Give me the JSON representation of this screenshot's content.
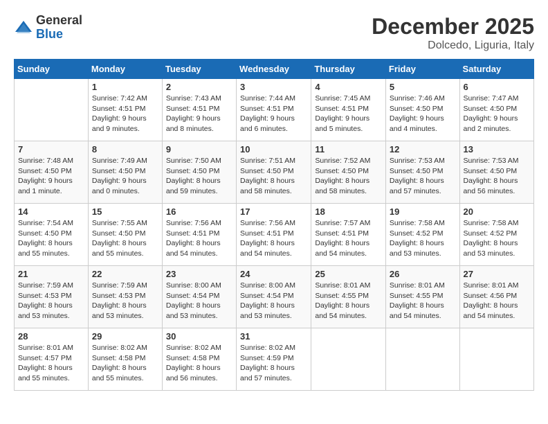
{
  "header": {
    "logo_general": "General",
    "logo_blue": "Blue",
    "month_year": "December 2025",
    "location": "Dolcedo, Liguria, Italy"
  },
  "calendar": {
    "days_of_week": [
      "Sunday",
      "Monday",
      "Tuesday",
      "Wednesday",
      "Thursday",
      "Friday",
      "Saturday"
    ],
    "weeks": [
      [
        {
          "day": "",
          "info": ""
        },
        {
          "day": "1",
          "info": "Sunrise: 7:42 AM\nSunset: 4:51 PM\nDaylight: 9 hours\nand 9 minutes."
        },
        {
          "day": "2",
          "info": "Sunrise: 7:43 AM\nSunset: 4:51 PM\nDaylight: 9 hours\nand 8 minutes."
        },
        {
          "day": "3",
          "info": "Sunrise: 7:44 AM\nSunset: 4:51 PM\nDaylight: 9 hours\nand 6 minutes."
        },
        {
          "day": "4",
          "info": "Sunrise: 7:45 AM\nSunset: 4:51 PM\nDaylight: 9 hours\nand 5 minutes."
        },
        {
          "day": "5",
          "info": "Sunrise: 7:46 AM\nSunset: 4:50 PM\nDaylight: 9 hours\nand 4 minutes."
        },
        {
          "day": "6",
          "info": "Sunrise: 7:47 AM\nSunset: 4:50 PM\nDaylight: 9 hours\nand 2 minutes."
        }
      ],
      [
        {
          "day": "7",
          "info": "Sunrise: 7:48 AM\nSunset: 4:50 PM\nDaylight: 9 hours\nand 1 minute."
        },
        {
          "day": "8",
          "info": "Sunrise: 7:49 AM\nSunset: 4:50 PM\nDaylight: 9 hours\nand 0 minutes."
        },
        {
          "day": "9",
          "info": "Sunrise: 7:50 AM\nSunset: 4:50 PM\nDaylight: 8 hours\nand 59 minutes."
        },
        {
          "day": "10",
          "info": "Sunrise: 7:51 AM\nSunset: 4:50 PM\nDaylight: 8 hours\nand 58 minutes."
        },
        {
          "day": "11",
          "info": "Sunrise: 7:52 AM\nSunset: 4:50 PM\nDaylight: 8 hours\nand 58 minutes."
        },
        {
          "day": "12",
          "info": "Sunrise: 7:53 AM\nSunset: 4:50 PM\nDaylight: 8 hours\nand 57 minutes."
        },
        {
          "day": "13",
          "info": "Sunrise: 7:53 AM\nSunset: 4:50 PM\nDaylight: 8 hours\nand 56 minutes."
        }
      ],
      [
        {
          "day": "14",
          "info": "Sunrise: 7:54 AM\nSunset: 4:50 PM\nDaylight: 8 hours\nand 55 minutes."
        },
        {
          "day": "15",
          "info": "Sunrise: 7:55 AM\nSunset: 4:50 PM\nDaylight: 8 hours\nand 55 minutes."
        },
        {
          "day": "16",
          "info": "Sunrise: 7:56 AM\nSunset: 4:51 PM\nDaylight: 8 hours\nand 54 minutes."
        },
        {
          "day": "17",
          "info": "Sunrise: 7:56 AM\nSunset: 4:51 PM\nDaylight: 8 hours\nand 54 minutes."
        },
        {
          "day": "18",
          "info": "Sunrise: 7:57 AM\nSunset: 4:51 PM\nDaylight: 8 hours\nand 54 minutes."
        },
        {
          "day": "19",
          "info": "Sunrise: 7:58 AM\nSunset: 4:52 PM\nDaylight: 8 hours\nand 53 minutes."
        },
        {
          "day": "20",
          "info": "Sunrise: 7:58 AM\nSunset: 4:52 PM\nDaylight: 8 hours\nand 53 minutes."
        }
      ],
      [
        {
          "day": "21",
          "info": "Sunrise: 7:59 AM\nSunset: 4:53 PM\nDaylight: 8 hours\nand 53 minutes."
        },
        {
          "day": "22",
          "info": "Sunrise: 7:59 AM\nSunset: 4:53 PM\nDaylight: 8 hours\nand 53 minutes."
        },
        {
          "day": "23",
          "info": "Sunrise: 8:00 AM\nSunset: 4:54 PM\nDaylight: 8 hours\nand 53 minutes."
        },
        {
          "day": "24",
          "info": "Sunrise: 8:00 AM\nSunset: 4:54 PM\nDaylight: 8 hours\nand 53 minutes."
        },
        {
          "day": "25",
          "info": "Sunrise: 8:01 AM\nSunset: 4:55 PM\nDaylight: 8 hours\nand 54 minutes."
        },
        {
          "day": "26",
          "info": "Sunrise: 8:01 AM\nSunset: 4:55 PM\nDaylight: 8 hours\nand 54 minutes."
        },
        {
          "day": "27",
          "info": "Sunrise: 8:01 AM\nSunset: 4:56 PM\nDaylight: 8 hours\nand 54 minutes."
        }
      ],
      [
        {
          "day": "28",
          "info": "Sunrise: 8:01 AM\nSunset: 4:57 PM\nDaylight: 8 hours\nand 55 minutes."
        },
        {
          "day": "29",
          "info": "Sunrise: 8:02 AM\nSunset: 4:58 PM\nDaylight: 8 hours\nand 55 minutes."
        },
        {
          "day": "30",
          "info": "Sunrise: 8:02 AM\nSunset: 4:58 PM\nDaylight: 8 hours\nand 56 minutes."
        },
        {
          "day": "31",
          "info": "Sunrise: 8:02 AM\nSunset: 4:59 PM\nDaylight: 8 hours\nand 57 minutes."
        },
        {
          "day": "",
          "info": ""
        },
        {
          "day": "",
          "info": ""
        },
        {
          "day": "",
          "info": ""
        }
      ]
    ]
  }
}
